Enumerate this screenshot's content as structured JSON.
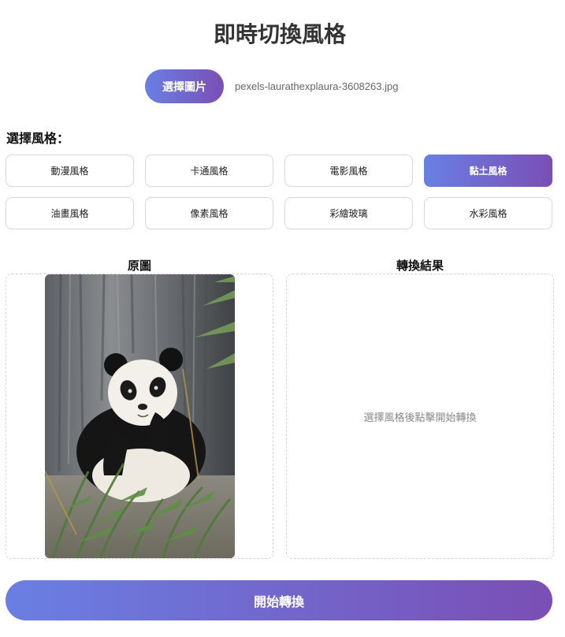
{
  "header": {
    "title": "即時切換風格"
  },
  "upload": {
    "choose_label": "選擇圖片",
    "file_name": "pexels-laurathexplaura-3608263.jpg"
  },
  "styles": {
    "section_label": "選擇風格：",
    "selected": "黏土風格",
    "items": [
      {
        "label": "動漫風格"
      },
      {
        "label": "卡通風格"
      },
      {
        "label": "電影風格"
      },
      {
        "label": "黏土風格"
      },
      {
        "label": "油畫風格"
      },
      {
        "label": "像素風格"
      },
      {
        "label": "彩繪玻璃"
      },
      {
        "label": "水彩風格"
      }
    ]
  },
  "original": {
    "label": "原圖",
    "image_subject": "giant panda eating bamboo"
  },
  "result": {
    "label": "轉換結果",
    "placeholder": "選擇風格後點擊開始轉換"
  },
  "actions": {
    "start_label": "開始轉換"
  },
  "colors": {
    "gradient_start": "#6a7fe3",
    "gradient_end": "#7a4fb5",
    "border": "#d8d8d8",
    "text_muted": "#888888"
  }
}
